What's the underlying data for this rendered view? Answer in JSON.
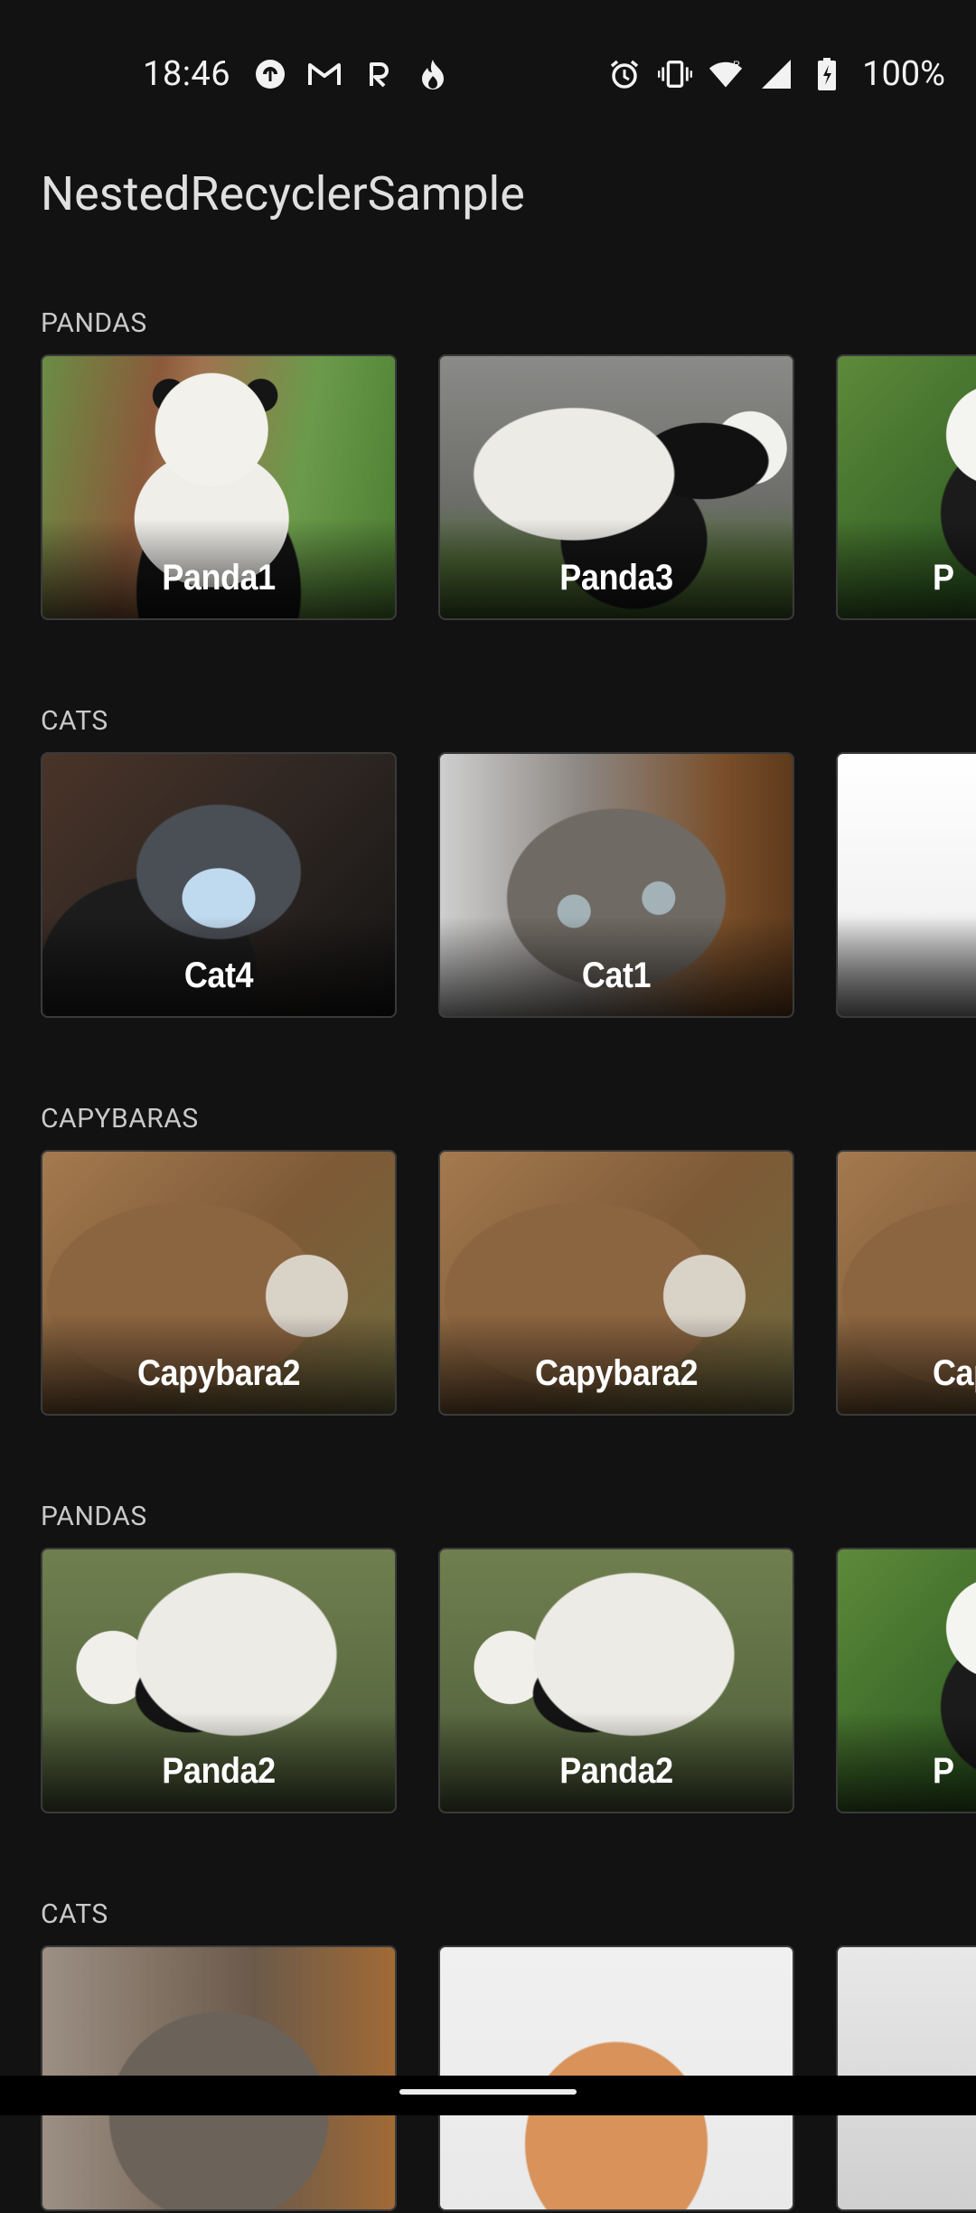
{
  "status_bar": {
    "time": "18:46",
    "battery": "100%",
    "left_icons": [
      "pocket-casts-icon",
      "gmail-icon",
      "reddit-icon",
      "fire-icon"
    ],
    "right_icons": [
      "alarm-icon",
      "vibrate-icon",
      "wifi-icon",
      "signal-icon",
      "battery-charging-icon"
    ]
  },
  "app": {
    "title": "NestedRecyclerSample"
  },
  "sections": [
    {
      "label": "PANDAS",
      "cards": [
        "Panda1",
        "Panda3",
        "P"
      ]
    },
    {
      "label": "CATS",
      "cards": [
        "Cat4",
        "Cat1",
        ""
      ]
    },
    {
      "label": "CAPYBARAS",
      "cards": [
        "Capybara2",
        "Capybara2",
        "Cap"
      ]
    },
    {
      "label": "PANDAS",
      "cards": [
        "Panda2",
        "Panda2",
        "P"
      ]
    },
    {
      "label": "CATS",
      "cards": [
        "",
        "",
        ""
      ]
    }
  ]
}
